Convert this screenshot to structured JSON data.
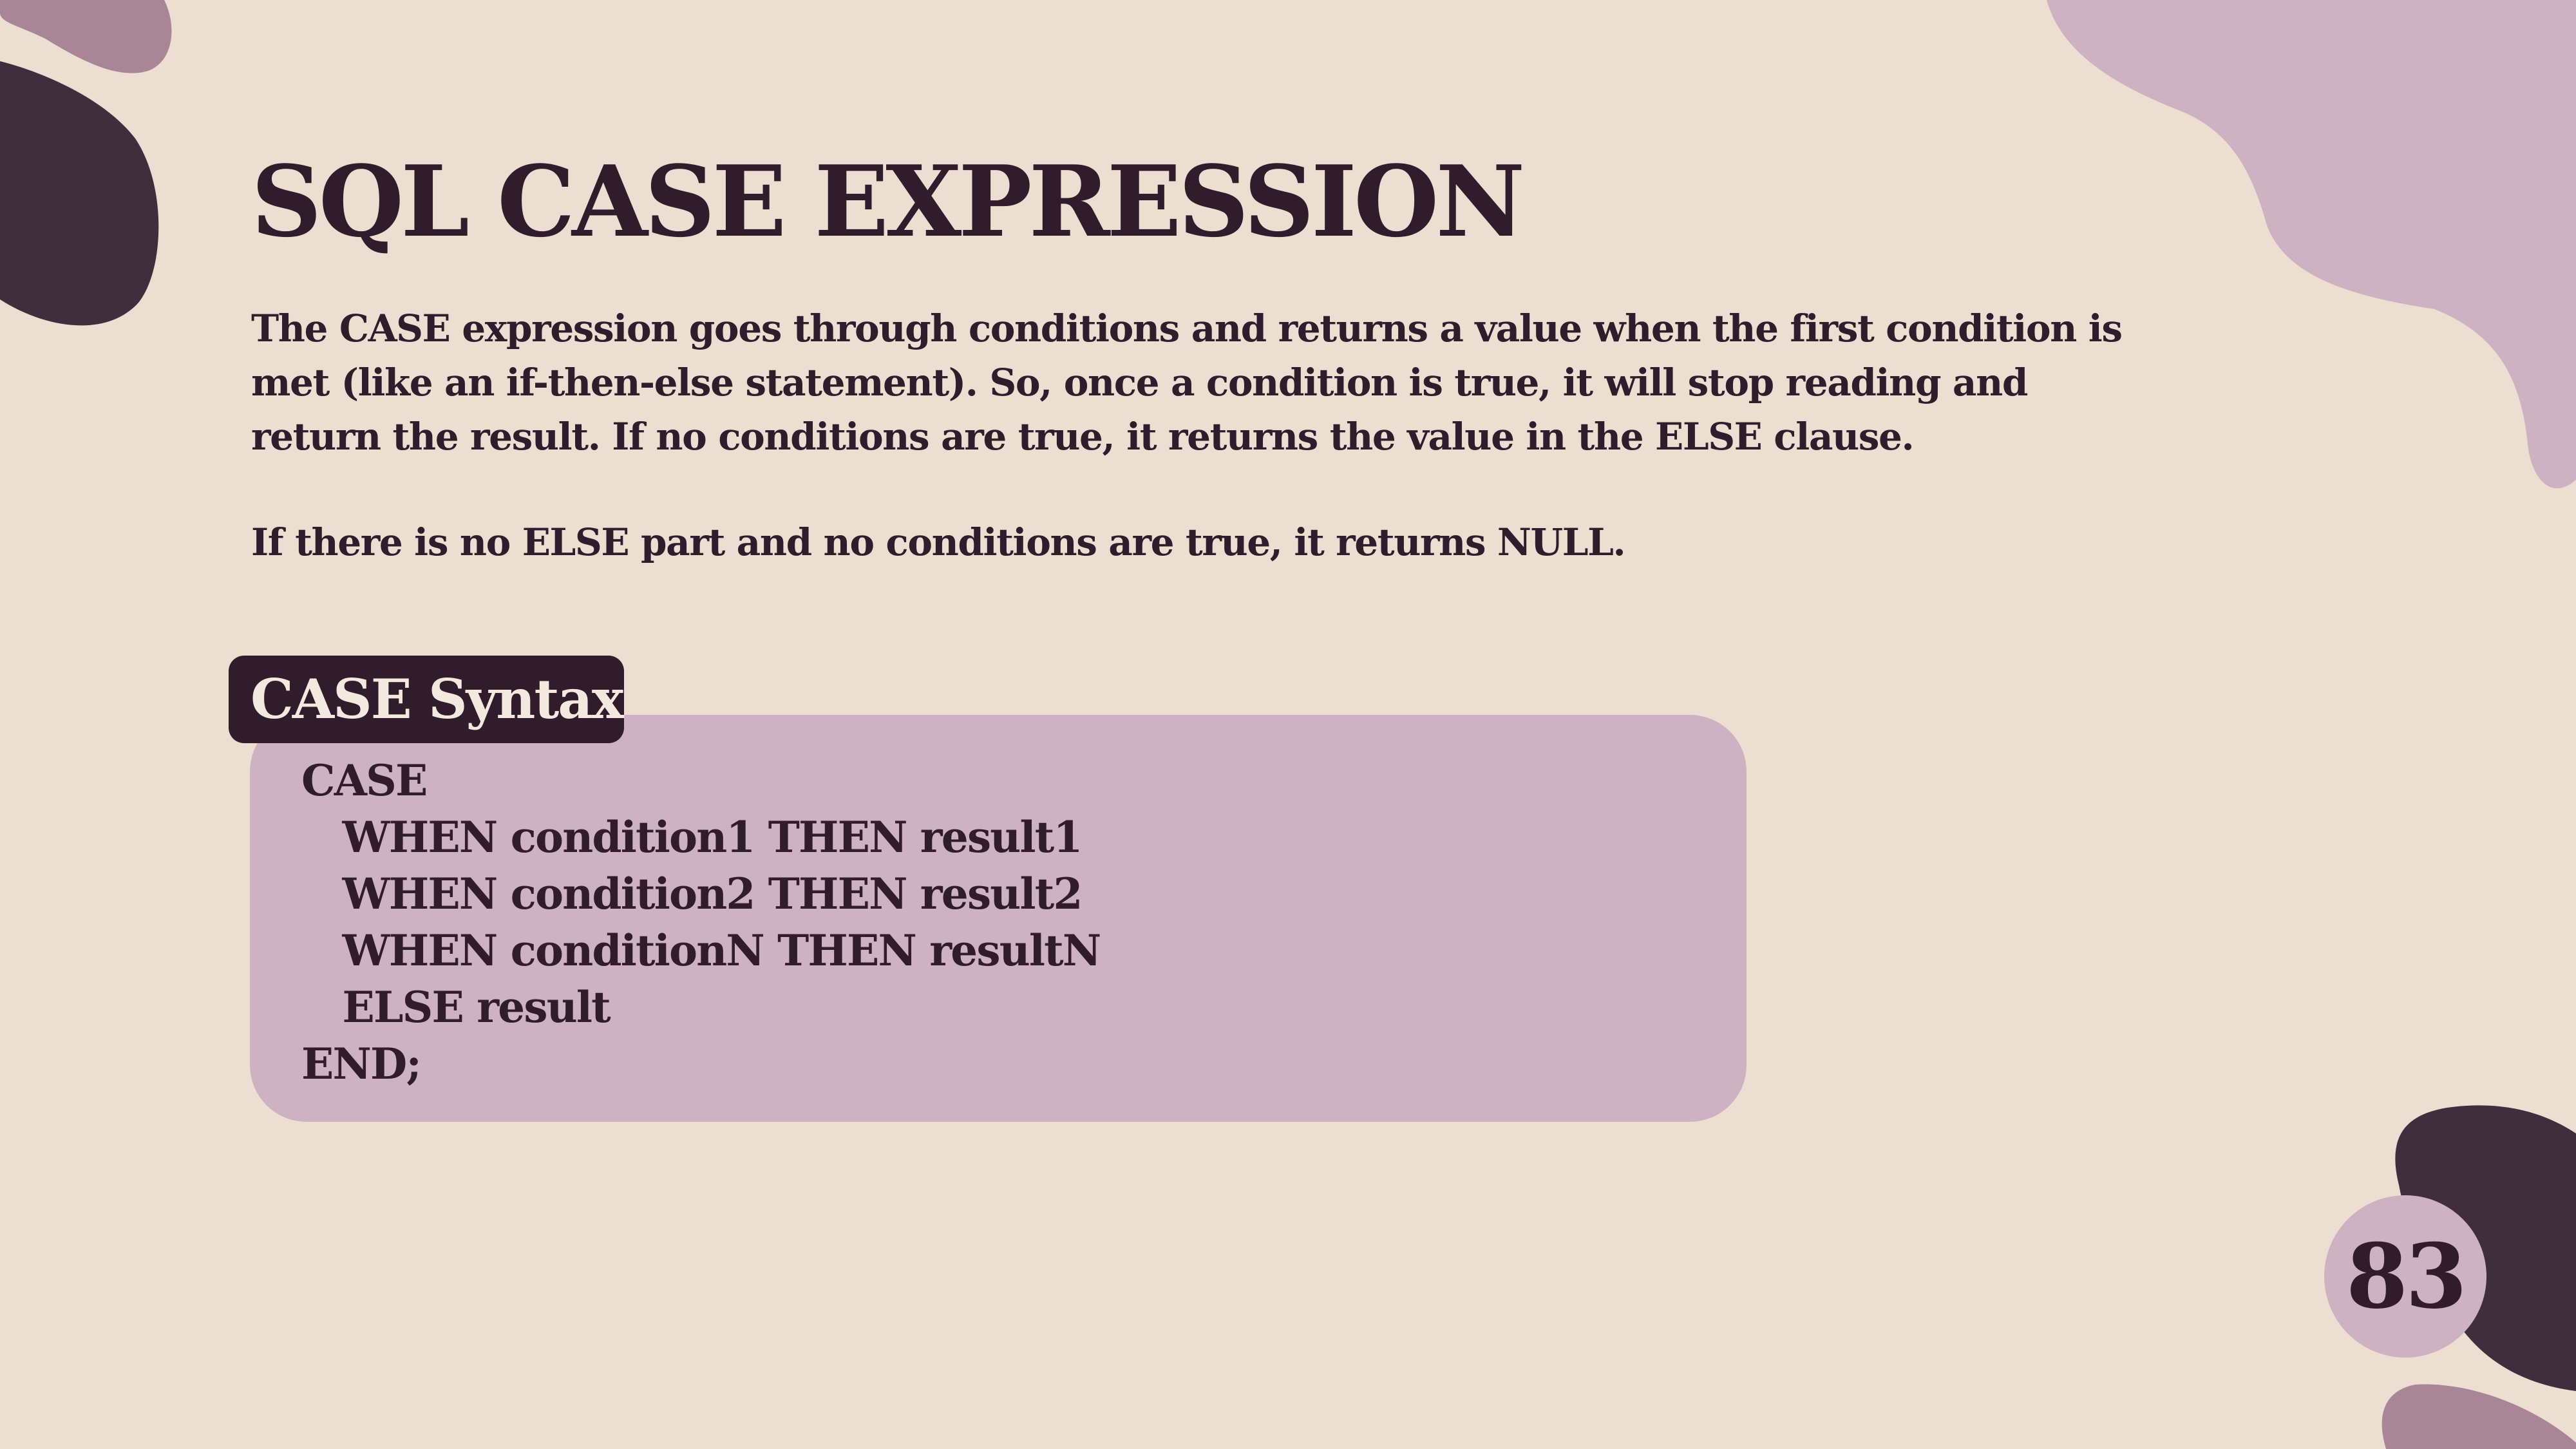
{
  "slide": {
    "title": "SQL CASE EXPRESSION",
    "description": "The CASE expression goes through conditions and returns a value when the first condition is met (like an if-then-else statement). So, once a condition is true, it will stop reading and return the result. If no conditions are true, it returns the value in the ELSE clause.",
    "note": "If there is no ELSE part and no conditions are true, it returns NULL.",
    "syntax_label": "CASE Syntax",
    "syntax_lines": [
      "CASE",
      "   WHEN condition1 THEN result1",
      "   WHEN condition2 THEN result2",
      "   WHEN conditionN THEN resultN",
      "   ELSE result",
      "END;"
    ],
    "page_number": "83"
  },
  "colors": {
    "background": "#ecdfd2",
    "dark_plum": "#3f2e3c",
    "text": "#301c2b",
    "mauve": "#cdb3c1",
    "dusty_pink": "#a98696"
  }
}
